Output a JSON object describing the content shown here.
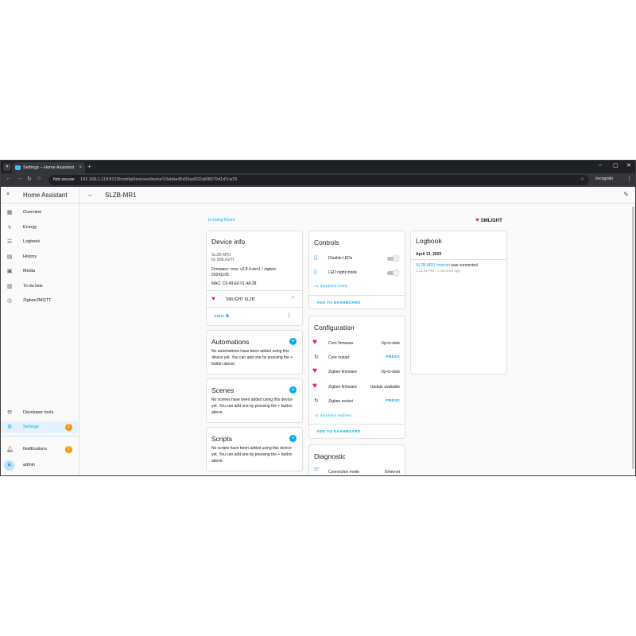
{
  "browser": {
    "tab_title": "Settings – Home Assistant",
    "tab_close": "×",
    "new_tab": "+",
    "not_secure": "Not secure",
    "url": "192.168.1.118:8123/config/devices/device/10ebba45d36ad932a6f8979d1d7ca79",
    "incognito": "Incognito",
    "controls": {
      "minimize": "–",
      "restore": "▢",
      "close": "✕"
    }
  },
  "sidebar": {
    "app_title": "Home Assistant",
    "items": [
      {
        "label": "Overview",
        "icon": "dashboard-icon",
        "glyph": "▦"
      },
      {
        "label": "Energy",
        "icon": "lightning-icon",
        "glyph": "ϟ"
      },
      {
        "label": "Logbook",
        "icon": "list-icon",
        "glyph": "☰"
      },
      {
        "label": "History",
        "icon": "chart-icon",
        "glyph": "▤"
      },
      {
        "label": "Media",
        "icon": "media-icon",
        "glyph": "▣"
      },
      {
        "label": "To-do lists",
        "icon": "clipboard-icon",
        "glyph": "▥"
      },
      {
        "label": "Zigbee2MQTT",
        "icon": "zigbee-icon",
        "glyph": "◎"
      }
    ],
    "developer_tools": "Developer tools",
    "settings": "Settings",
    "settings_badge": "1",
    "notifications": "Notifications",
    "notifications_badge": "1",
    "user": "admin",
    "user_initial": "a"
  },
  "header": {
    "device_name": "SLZB-MR1"
  },
  "area_link": "In Living Room",
  "brand": "SMLIGHT",
  "device_info": {
    "title": "Device info",
    "model": "SLZB-MR1",
    "manufacturer": "by SMLIGHT",
    "firmware_line1": "Firmware: core: v2.8.4.dev1 / zigbee:",
    "firmware_line2": "20241105",
    "mac": "MAC: C0:49:EF:01:4A:38",
    "integration": "SMLIGHT SLZB",
    "visit": "VISIT"
  },
  "automations": {
    "title": "Automations",
    "text1": "No automations have been added using this",
    "text2": "device yet. You can add one by pressing the +",
    "text3": "button above."
  },
  "scenes": {
    "title": "Scenes",
    "text1": "No scenes have been added using this device",
    "text2": "yet. You can add one by pressing the + button",
    "text3": "above."
  },
  "scripts": {
    "title": "Scripts",
    "text1": "No scripts have been added using this device",
    "text2": "yet. You can add one by pressing the + button",
    "text3": "above."
  },
  "controls": {
    "title": "Controls",
    "rows": [
      {
        "label": "Disable LEDs"
      },
      {
        "label": "LED night mode"
      }
    ],
    "disabled": "+1 disabled entity",
    "add": "ADD TO DASHBOARD"
  },
  "configuration": {
    "title": "Configuration",
    "rows": [
      {
        "label": "Core firmware",
        "value": "Up-to-date",
        "icon": "heart-icon"
      },
      {
        "label": "Core restart",
        "value": "PRESS",
        "icon": "restart-icon"
      },
      {
        "label": "Zigbee firmware",
        "value": "Up-to-date",
        "icon": "heart-icon"
      },
      {
        "label": "Zigbee firmware",
        "value": "Update available",
        "icon": "heart-icon"
      },
      {
        "label": "Zigbee restart",
        "value": "PRESS",
        "icon": "restart-icon"
      }
    ],
    "disabled": "+2 disabled entities",
    "add": "ADD TO DASHBOARD"
  },
  "diagnostic": {
    "title": "Diagnostic",
    "rows": [
      {
        "label": "Connection mode",
        "value": "Ethernet"
      }
    ]
  },
  "logbook": {
    "title": "Logbook",
    "date": "April 13, 2025",
    "entry_entity": "SLZB-MR1 Internet",
    "entry_text": " was connected",
    "entry_time": "1:11:04 PM - 6 seconds ago"
  },
  "colors": {
    "accent": "#03a9f4",
    "badge": "#ff9800",
    "brand": "#e91e63"
  }
}
